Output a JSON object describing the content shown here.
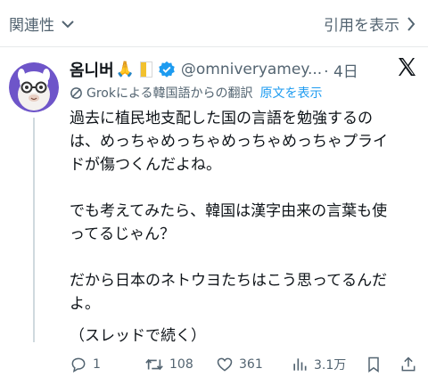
{
  "topbar": {
    "left_label": "関連性",
    "right_label": "引用を表示"
  },
  "tweet": {
    "author_name": "옴니버",
    "author_emoji": "🙏",
    "handle": "@omniveryamey...",
    "time_label": "· 4日",
    "translation_label": "Grokによる韓国語からの翻訳",
    "show_original_label": "原文を表示",
    "lines": [
      "過去に植民地支配した国の言語を勉強するの",
      "は、めっちゃめっちゃめっちゃめっちゃプライ",
      "ドが傷つくんだよね。",
      "でも考えてみたら、韓国は漢字由来の言葉も使",
      "ってるじゃん？",
      "だから日本のネトウヨたちはこう思ってるんだ",
      "よ。",
      "（スレッドで続く）"
    ]
  },
  "actions": {
    "replies": "1",
    "reposts": "108",
    "likes": "361",
    "views": "3.1万"
  },
  "colors": {
    "accent": "#1d9bf0",
    "muted": "#536471",
    "text": "#0f1419"
  }
}
